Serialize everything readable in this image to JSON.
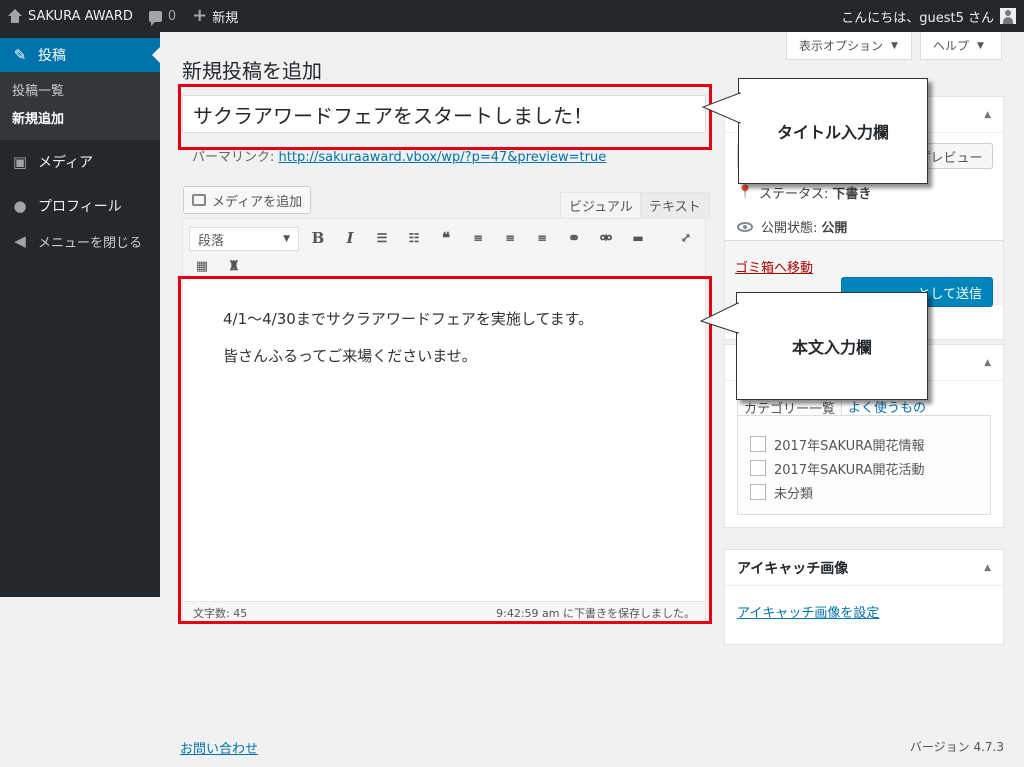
{
  "adminbar": {
    "site_name": "SAKURA AWARD",
    "comments_count": "0",
    "new_label": "新規",
    "greeting": "こんにちは、guest5 さん"
  },
  "sidebar": {
    "posts": "投稿",
    "posts_list": "投稿一覧",
    "add_new": "新規追加",
    "media": "メディア",
    "profile": "プロフィール",
    "collapse": "メニューを閉じる"
  },
  "header": {
    "screen_options": "表示オプション",
    "help": "ヘルプ",
    "title": "新規投稿を追加"
  },
  "post": {
    "title_value": "サクラアワードフェアをスタートしました！",
    "permalink_label": "パーマリンク:",
    "permalink_url": "http://sakuraaward.vbox/wp/?p=47&preview=true"
  },
  "editor": {
    "add_media": "メディアを追加",
    "tab_visual": "ビジュアル",
    "tab_text": "テキスト",
    "format_select": "段落",
    "content_p1": "4/1～4/30までサクラアワードフェアを実施してます。",
    "content_p2": "皆さんふるってご来場くださいませ。",
    "word_count": "文字数: 45",
    "autosave": "9:42:59 am に下書きを保存しました。"
  },
  "annotations": {
    "title_callout": "タイトル入力欄",
    "body_callout": "本文入力欄",
    "highlight_color": "#e60012"
  },
  "publish": {
    "preview": "プレビュー",
    "status_label": "ステータス:",
    "status_value": "下書き",
    "visibility_label": "公開状態:",
    "visibility_value": "公開",
    "trash": "ゴミ箱へ移動",
    "submit": "として送信"
  },
  "categories": {
    "tab_all": "カテゴリー一覧",
    "tab_popular": "よく使うもの",
    "items": [
      "2017年SAKURA開花情報",
      "2017年SAKURA開花活動",
      "未分類"
    ]
  },
  "featured": {
    "heading": "アイキャッチ画像",
    "set_link": "アイキャッチ画像を設定"
  },
  "footer": {
    "contact": "お問い合わせ",
    "version": "バージョン 4.7.3"
  }
}
